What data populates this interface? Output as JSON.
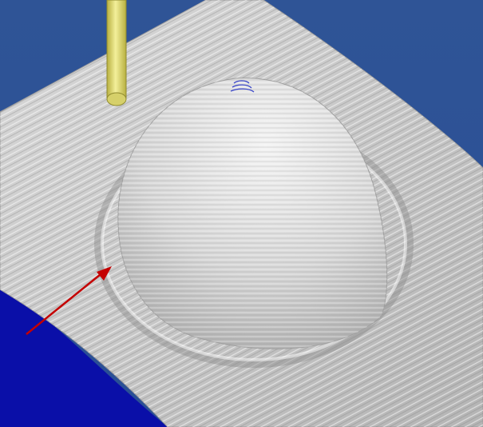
{
  "scene": {
    "description_kind": "cnc-toolpath-simulation-viewport",
    "colors": {
      "background_top": "#2f5496",
      "background_bottom": "#0a0fa8",
      "surface": "#c9c9c9",
      "surface_shadow": "#9a9a9a",
      "surface_highlight": "#f2f2f2",
      "tool": "#e8e27a",
      "tool_shade": "#b8b040",
      "arrow": "#c40000"
    },
    "objects": {
      "machined_surface": "machined-surface",
      "dome": "dome-feature",
      "tool": "cutting-tool",
      "arrow": "annotation-arrow"
    }
  }
}
